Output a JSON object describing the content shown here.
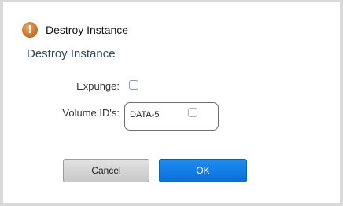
{
  "dialog": {
    "title": "Destroy Instance",
    "heading": "Destroy Instance",
    "icon": "warning-icon",
    "icon_color": "#c8742c"
  },
  "form": {
    "expunge_label": "Expunge:",
    "expunge_checked": false,
    "volume_label": "Volume ID's:",
    "volumes": [
      {
        "name": "DATA-5",
        "checked": false
      }
    ]
  },
  "buttons": {
    "cancel_label": "Cancel",
    "ok_label": "OK",
    "ok_color": "#0a7ae6"
  }
}
